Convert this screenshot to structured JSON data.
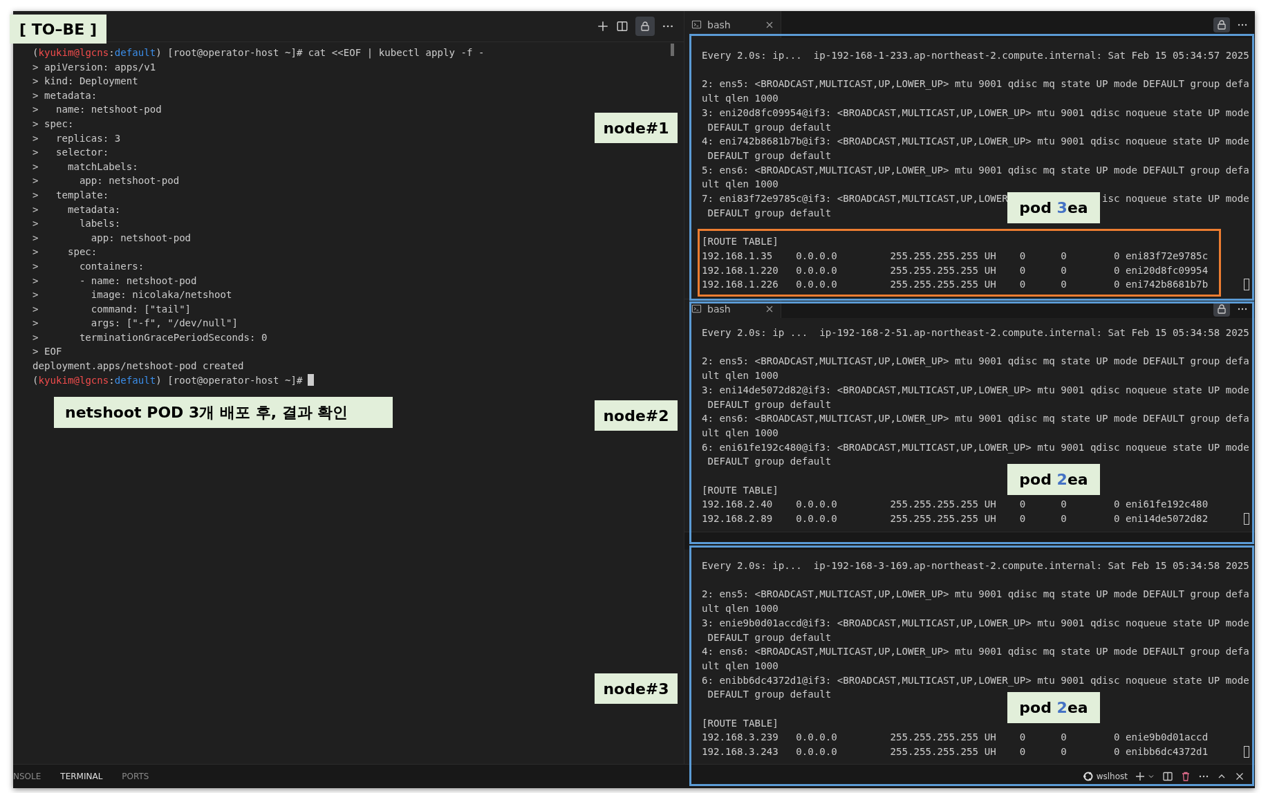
{
  "annotations": {
    "title": "[ TO–BE ]",
    "caption": "netshoot POD 3개 배포 후, 결과 확인",
    "nodes": [
      "node#1",
      "node#2",
      "node#3"
    ],
    "pods": [
      {
        "prefix": "pod ",
        "count": "3",
        "suffix": "ea"
      },
      {
        "prefix": "pod ",
        "count": "2",
        "suffix": "ea"
      },
      {
        "prefix": "pod ",
        "count": "2",
        "suffix": "ea"
      }
    ]
  },
  "left_terminal": {
    "lines": [
      {
        "kind": "prompt",
        "cursor": false,
        "open": "(",
        "user": "kyukim@lgcns",
        "sep": ":",
        "context": "default",
        "rest": ") [root@operator-host ~]# cat <<EOF | kubectl apply -f -"
      },
      {
        "kind": "text",
        "text": "> apiVersion: apps/v1"
      },
      {
        "kind": "text",
        "text": "> kind: Deployment"
      },
      {
        "kind": "text",
        "text": "> metadata:"
      },
      {
        "kind": "text",
        "text": ">   name: netshoot-pod"
      },
      {
        "kind": "text",
        "text": "> spec:"
      },
      {
        "kind": "text",
        "text": ">   replicas: 3"
      },
      {
        "kind": "text",
        "text": ">   selector:"
      },
      {
        "kind": "text",
        "text": ">     matchLabels:"
      },
      {
        "kind": "text",
        "text": ">       app: netshoot-pod"
      },
      {
        "kind": "text",
        "text": ">   template:"
      },
      {
        "kind": "text",
        "text": ">     metadata:"
      },
      {
        "kind": "text",
        "text": ">       labels:"
      },
      {
        "kind": "text",
        "text": ">         app: netshoot-pod"
      },
      {
        "kind": "text",
        "text": ">     spec:"
      },
      {
        "kind": "text",
        "text": ">       containers:"
      },
      {
        "kind": "text",
        "text": ">       - name: netshoot-pod"
      },
      {
        "kind": "text",
        "text": ">         image: nicolaka/netshoot"
      },
      {
        "kind": "text",
        "text": ">         command: [\"tail\"]"
      },
      {
        "kind": "text",
        "text": ">         args: [\"-f\", \"/dev/null\"]"
      },
      {
        "kind": "text",
        "text": ">       terminationGracePeriodSeconds: 0"
      },
      {
        "kind": "text",
        "text": "> EOF"
      },
      {
        "kind": "text",
        "text": "deployment.apps/netshoot-pod created"
      },
      {
        "kind": "prompt",
        "cursor": true,
        "open": "(",
        "user": "kyukim@lgcns",
        "sep": ":",
        "context": "default",
        "rest": ") [root@operator-host ~]#"
      }
    ]
  },
  "panes": [
    {
      "tab": "bash",
      "cursor": true,
      "blocks": [
        [
          "Every 2.0s: ip...  ip-192-168-1-233.ap-northeast-2.compute.internal: Sat Feb 15 05:34:57 2025"
        ],
        [
          "2: ens5: <BROADCAST,MULTICAST,UP,LOWER_UP> mtu 9001 qdisc mq state UP mode DEFAULT group defa",
          "ult qlen 1000",
          "3: eni20d8fc09954@if3: <BROADCAST,MULTICAST,UP,LOWER_UP> mtu 9001 qdisc noqueue state UP mode",
          " DEFAULT group default",
          "4: eni742b8681b7b@if3: <BROADCAST,MULTICAST,UP,LOWER_UP> mtu 9001 qdisc noqueue state UP mode",
          " DEFAULT group default",
          "5: ens6: <BROADCAST,MULTICAST,UP,LOWER_UP> mtu 9001 qdisc mq state UP mode DEFAULT group defa",
          "ult qlen 1000",
          {
            "segments": [
              "7: eni83f72e9785c@if3: <BROADCAST,MULTICAST,UP,LOWER",
              "isc noqueue state UP mode"
            ]
          },
          " DEFAULT group default"
        ],
        [
          "[ROUTE TABLE]",
          "192.168.1.35    0.0.0.0         255.255.255.255 UH    0      0        0 eni83f72e9785c",
          "192.168.1.220   0.0.0.0         255.255.255.255 UH    0      0        0 eni20d8fc09954",
          "192.168.1.226   0.0.0.0         255.255.255.255 UH    0      0        0 eni742b8681b7b"
        ]
      ]
    },
    {
      "tab": "bash",
      "cursor": true,
      "blocks": [
        [
          "Every 2.0s: ip ...  ip-192-168-2-51.ap-northeast-2.compute.internal: Sat Feb 15 05:34:58 2025"
        ],
        [
          "2: ens5: <BROADCAST,MULTICAST,UP,LOWER_UP> mtu 9001 qdisc mq state UP mode DEFAULT group defa",
          "ult qlen 1000",
          "3: eni14de5072d82@if3: <BROADCAST,MULTICAST,UP,LOWER_UP> mtu 9001 qdisc noqueue state UP mode",
          " DEFAULT group default",
          "4: ens6: <BROADCAST,MULTICAST,UP,LOWER_UP> mtu 9001 qdisc mq state UP mode DEFAULT group defa",
          "ult qlen 1000",
          "6: eni61fe192c480@if3: <BROADCAST,MULTICAST,UP,LOWER_UP> mtu 9001 qdisc noqueue state UP mode",
          " DEFAULT group default"
        ],
        [
          "[ROUTE TABLE]",
          "192.168.2.40    0.0.0.0         255.255.255.255 UH    0      0        0 eni61fe192c480",
          "192.168.2.89    0.0.0.0         255.255.255.255 UH    0      0        0 eni14de5072d82"
        ]
      ]
    },
    {
      "cursor": true,
      "blocks": [
        [
          "Every 2.0s: ip...  ip-192-168-3-169.ap-northeast-2.compute.internal: Sat Feb 15 05:34:58 2025"
        ],
        [
          "2: ens5: <BROADCAST,MULTICAST,UP,LOWER_UP> mtu 9001 qdisc mq state UP mode DEFAULT group defa",
          "ult qlen 1000",
          "3: enie9b0d01accd@if3: <BROADCAST,MULTICAST,UP,LOWER_UP> mtu 9001 qdisc noqueue state UP mode",
          " DEFAULT group default",
          "4: ens6: <BROADCAST,MULTICAST,UP,LOWER_UP> mtu 9001 qdisc mq state UP mode DEFAULT group defa",
          "ult qlen 1000",
          "6: enibb6dc4372d1@if3: <BROADCAST,MULTICAST,UP,LOWER_UP> mtu 9001 qdisc noqueue state UP mode",
          " DEFAULT group default"
        ],
        [
          "[ROUTE TABLE]",
          "192.168.3.239   0.0.0.0         255.255.255.255 UH    0      0        0 enie9b0d01accd",
          "192.168.3.243   0.0.0.0         255.255.255.255 UH    0      0        0 enibb6dc4372d1"
        ]
      ]
    }
  ],
  "bottom_bar": {
    "tabs": [
      {
        "label": "NSOLE",
        "selected": false
      },
      {
        "label": "TERMINAL",
        "selected": true
      },
      {
        "label": "PORTS",
        "selected": false
      }
    ],
    "profile": "wslhost"
  }
}
